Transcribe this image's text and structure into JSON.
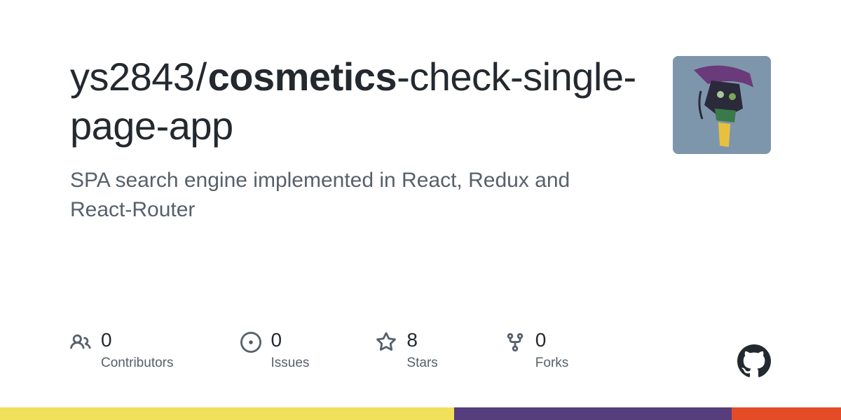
{
  "repo": {
    "owner": "ys2843",
    "slash": "/",
    "name_bold": "cosmetics",
    "name_rest": "-check-single-page-app",
    "description": "SPA search engine implemented in React, Redux and React-Router"
  },
  "stats": {
    "contributors": {
      "value": "0",
      "label": "Contributors"
    },
    "issues": {
      "value": "0",
      "label": "Issues"
    },
    "stars": {
      "value": "8",
      "label": "Stars"
    },
    "forks": {
      "value": "0",
      "label": "Forks"
    }
  },
  "colors": {
    "segments": [
      {
        "color": "#f1e05a",
        "width": "54%"
      },
      {
        "color": "#563d7c",
        "width": "33%"
      },
      {
        "color": "#e34c26",
        "width": "13%"
      }
    ]
  }
}
